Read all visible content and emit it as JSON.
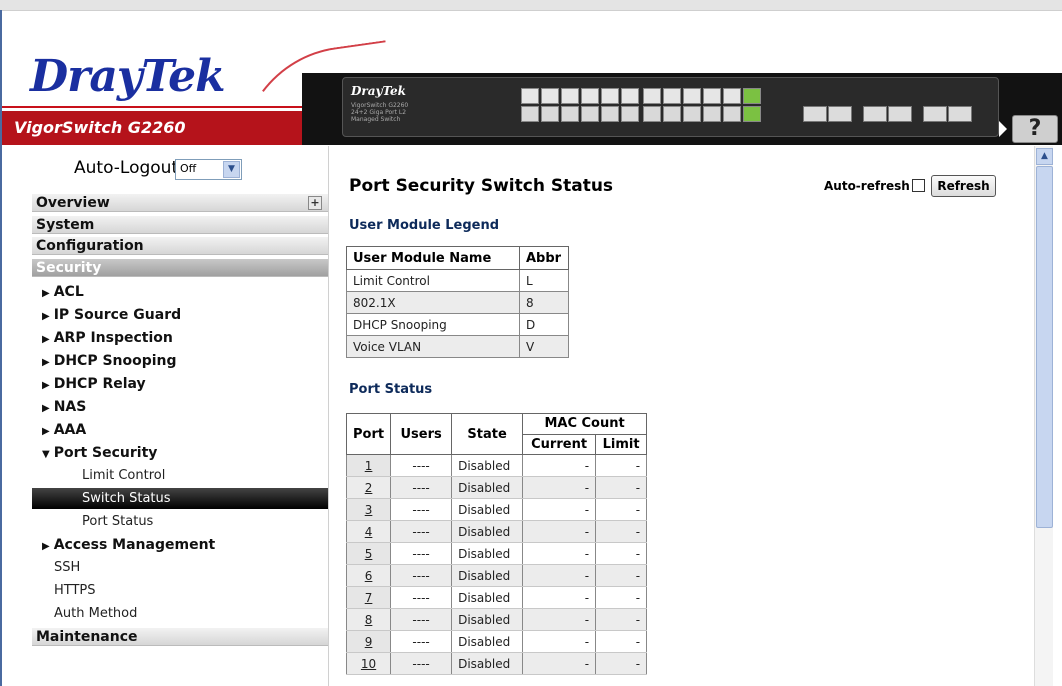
{
  "header": {
    "brand": {
      "dray": "Dray",
      "tek": "Tek"
    },
    "product_name": "VigorSwitch G2260",
    "device": {
      "logo": "DrayTek",
      "model": "VigorSwitch G2260",
      "sub": "24+2 Giga Port L2 Managed Switch"
    },
    "help_label": "?"
  },
  "sidebar": {
    "auto_logout_label": "Auto-Logout",
    "auto_logout_value": "Off",
    "sections": {
      "overview": "Overview",
      "system": "System",
      "configuration": "Configuration",
      "security": "Security",
      "maintenance": "Maintenance"
    },
    "security_items": {
      "acl": "ACL",
      "ip_source_guard": "IP Source Guard",
      "arp_inspection": "ARP Inspection",
      "dhcp_snooping": "DHCP Snooping",
      "dhcp_relay": "DHCP Relay",
      "nas": "NAS",
      "aaa": "AAA",
      "port_security": "Port Security",
      "limit_control": "Limit Control",
      "switch_status": "Switch Status",
      "port_status": "Port Status",
      "access_management": "Access Management",
      "ssh": "SSH",
      "https": "HTTPS",
      "auth_method": "Auth Method"
    }
  },
  "main": {
    "title": "Port Security Switch Status",
    "auto_refresh_label": "Auto-refresh",
    "refresh_label": "Refresh",
    "legend_title": "User Module Legend",
    "legend_headers": {
      "name": "User Module Name",
      "abbr": "Abbr"
    },
    "legend_rows": [
      {
        "name": "Limit Control",
        "abbr": "L"
      },
      {
        "name": "802.1X",
        "abbr": "8"
      },
      {
        "name": "DHCP Snooping",
        "abbr": "D"
      },
      {
        "name": "Voice VLAN",
        "abbr": "V"
      }
    ],
    "port_status_title": "Port Status",
    "port_headers": {
      "port": "Port",
      "users": "Users",
      "state": "State",
      "mac_count": "MAC Count",
      "current": "Current",
      "limit": "Limit"
    },
    "ports": [
      {
        "port": "1",
        "users": "----",
        "state": "Disabled",
        "current": "-",
        "limit": "-"
      },
      {
        "port": "2",
        "users": "----",
        "state": "Disabled",
        "current": "-",
        "limit": "-"
      },
      {
        "port": "3",
        "users": "----",
        "state": "Disabled",
        "current": "-",
        "limit": "-"
      },
      {
        "port": "4",
        "users": "----",
        "state": "Disabled",
        "current": "-",
        "limit": "-"
      },
      {
        "port": "5",
        "users": "----",
        "state": "Disabled",
        "current": "-",
        "limit": "-"
      },
      {
        "port": "6",
        "users": "----",
        "state": "Disabled",
        "current": "-",
        "limit": "-"
      },
      {
        "port": "7",
        "users": "----",
        "state": "Disabled",
        "current": "-",
        "limit": "-"
      },
      {
        "port": "8",
        "users": "----",
        "state": "Disabled",
        "current": "-",
        "limit": "-"
      },
      {
        "port": "9",
        "users": "----",
        "state": "Disabled",
        "current": "-",
        "limit": "-"
      },
      {
        "port": "10",
        "users": "----",
        "state": "Disabled",
        "current": "-",
        "limit": "-"
      }
    ]
  }
}
